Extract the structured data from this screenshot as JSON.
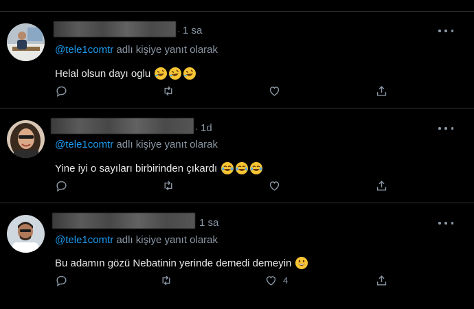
{
  "reply_prefix_joiner": " ",
  "tweets": [
    {
      "time": "1 sa",
      "reply_handle": "@tele1comtr",
      "reply_suffix": "adlı kişiye yanıt olarak",
      "text": "Helal olsun dayı oglu",
      "emoji_names": [
        "rolling-laughing-emoji",
        "rolling-laughing-emoji",
        "rolling-laughing-emoji"
      ],
      "like_count": ""
    },
    {
      "time": "1d",
      "reply_handle": "@tele1comtr",
      "reply_suffix": "adlı kişiye yanıt olarak",
      "text": "Yine iyi o sayıları birbirinden çıkardı",
      "emoji_names": [
        "tears-of-joy-emoji",
        "tears-of-joy-emoji",
        "tears-of-joy-emoji"
      ],
      "like_count": ""
    },
    {
      "time": "1 sa",
      "reply_handle": "@tele1comtr",
      "reply_suffix": "adlı kişiye yanıt olarak",
      "text": "Bu adamın gözü Nebatinin yerinde demedi demeyin",
      "emoji_names": [
        "grinning-emoji"
      ],
      "like_count": "4"
    }
  ],
  "icons": {
    "reply": "reply-icon",
    "retweet": "retweet-icon",
    "like": "like-icon",
    "share": "share-icon",
    "more": "more-options-icon"
  },
  "colors": {
    "background": "#000000",
    "handle": "#1d9bf0",
    "muted": "#8b98a5",
    "text": "#e7e9ea",
    "divider": "#2f3336",
    "emoji": "#f7c533"
  }
}
